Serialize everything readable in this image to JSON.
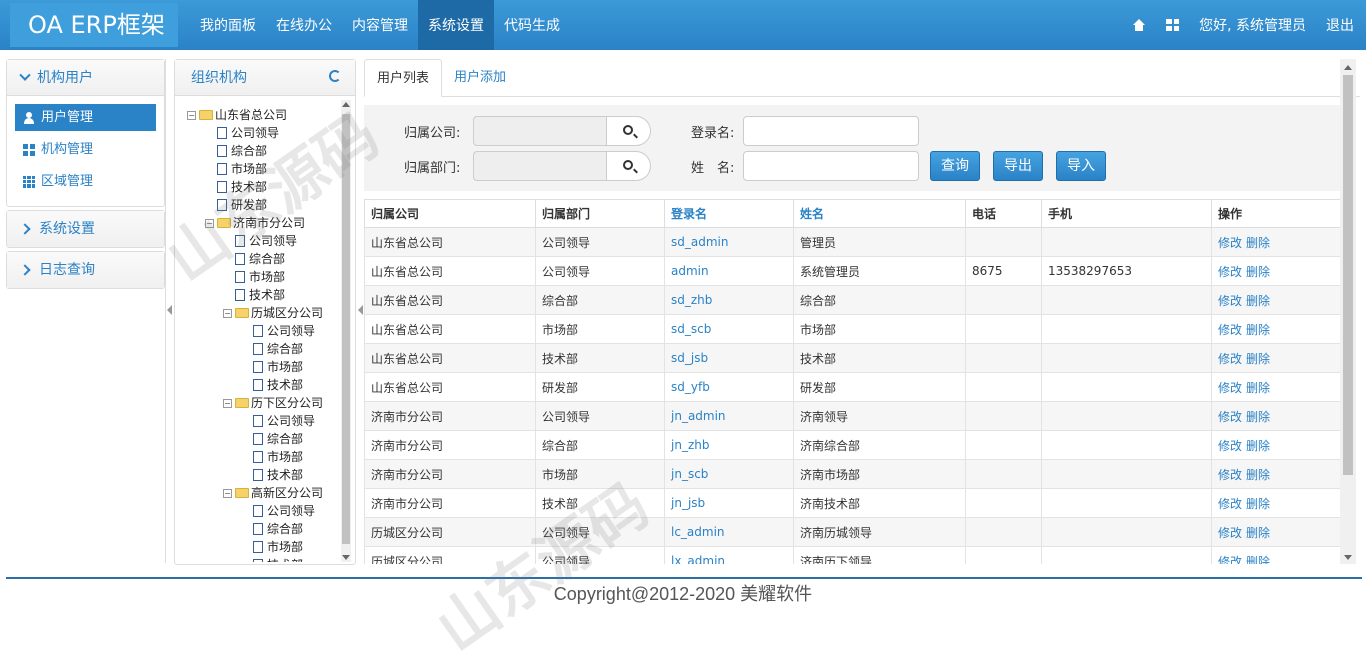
{
  "header": {
    "brand": "OA ERP框架",
    "nav": [
      "我的面板",
      "在线办公",
      "内容管理",
      "系统设置",
      "代码生成"
    ],
    "active_nav": "系统设置",
    "icons": [
      "home-icon",
      "grid-icon"
    ],
    "greeting": "您好, 系统管理员",
    "logout": "退出"
  },
  "sidebar": {
    "sections": [
      {
        "title": "机构用户",
        "expanded": true,
        "items": [
          {
            "label": "用户管理",
            "icon": "user-icon",
            "active": true
          },
          {
            "label": "机构管理",
            "icon": "grid-icon",
            "active": false
          },
          {
            "label": "区域管理",
            "icon": "grid-small-icon",
            "active": false
          }
        ]
      },
      {
        "title": "系统设置",
        "expanded": false
      },
      {
        "title": "日志查询",
        "expanded": false
      }
    ]
  },
  "tree": {
    "title": "组织机构",
    "refresh_icon": "refresh-icon",
    "nodes": [
      "山东省总公司",
      "公司领导",
      "综合部",
      "市场部",
      "技术部",
      "研发部",
      "济南市分公司",
      "公司领导",
      "综合部",
      "市场部",
      "技术部",
      "历城区分公司",
      "公司领导",
      "综合部",
      "市场部",
      "技术部",
      "历下区分公司",
      "公司领导",
      "综合部",
      "市场部",
      "技术部",
      "高新区分公司",
      "公司领导",
      "综合部",
      "市场部",
      "技术部"
    ]
  },
  "tabs": [
    "用户列表",
    "用户添加"
  ],
  "filter": {
    "company_label": "归属公司:",
    "dept_label": "归属部门:",
    "login_label": "登录名:",
    "name_label": "姓　名:",
    "login_value": "",
    "name_value": "",
    "buttons": [
      "查询",
      "导出",
      "导入"
    ]
  },
  "table": {
    "headers": [
      "归属公司",
      "归属部门",
      "登录名",
      "姓名",
      "电话",
      "手机",
      "操作"
    ],
    "rows": [
      [
        "山东省总公司",
        "公司领导",
        "sd_admin",
        "管理员",
        "",
        ""
      ],
      [
        "山东省总公司",
        "公司领导",
        "admin",
        "系统管理员",
        "8675",
        "13538297653"
      ],
      [
        "山东省总公司",
        "综合部",
        "sd_zhb",
        "综合部",
        "",
        ""
      ],
      [
        "山东省总公司",
        "市场部",
        "sd_scb",
        "市场部",
        "",
        ""
      ],
      [
        "山东省总公司",
        "技术部",
        "sd_jsb",
        "技术部",
        "",
        ""
      ],
      [
        "山东省总公司",
        "研发部",
        "sd_yfb",
        "研发部",
        "",
        ""
      ],
      [
        "济南市分公司",
        "公司领导",
        "jn_admin",
        "济南领导",
        "",
        ""
      ],
      [
        "济南市分公司",
        "综合部",
        "jn_zhb",
        "济南综合部",
        "",
        ""
      ],
      [
        "济南市分公司",
        "市场部",
        "jn_scb",
        "济南市场部",
        "",
        ""
      ],
      [
        "济南市分公司",
        "技术部",
        "jn_jsb",
        "济南技术部",
        "",
        ""
      ],
      [
        "历城区分公司",
        "公司领导",
        "lc_admin",
        "济南历城领导",
        "",
        ""
      ],
      [
        "历城区分公司",
        "公司领导",
        "lx_admin",
        "济南历下领导",
        "",
        ""
      ]
    ],
    "ops": [
      "修改",
      "删除"
    ]
  },
  "footer": "Copyright@2012-2020 美耀软件",
  "watermark": "山东源码"
}
